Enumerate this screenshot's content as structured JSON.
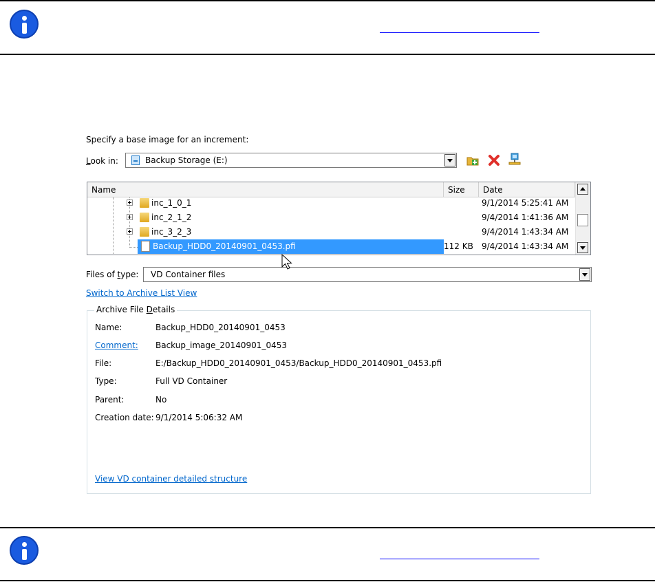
{
  "dialog": {
    "prompt": "Specify a base image for an increment:",
    "look_in": {
      "label": "Look in:",
      "value": "Backup Storage (E:)"
    },
    "toolbar": {
      "icons": [
        "new-folder-icon",
        "delete-icon",
        "network-icon"
      ]
    },
    "list": {
      "columns": [
        "Name",
        "Size",
        "Date"
      ],
      "rows": [
        {
          "name": "inc_1_0_1",
          "size": "",
          "date": "9/1/2014 5:25:41 AM",
          "type": "folder"
        },
        {
          "name": "inc_2_1_2",
          "size": "",
          "date": "9/4/2014 1:41:36 AM",
          "type": "folder"
        },
        {
          "name": "inc_3_2_3",
          "size": "",
          "date": "9/4/2014 1:43:34 AM",
          "type": "folder"
        },
        {
          "name": "Backup_HDD0_20140901_0453.pfi",
          "size": "112 KB",
          "date": "9/4/2014 1:43:34 AM",
          "type": "file",
          "selected": true
        }
      ]
    },
    "files_of_type": {
      "label": "Files of type:",
      "value": "VD Container files"
    },
    "switch_link": "Switch to Archive List View",
    "details": {
      "title": "Archive File Details",
      "rows": [
        {
          "key": "Name:",
          "value": "Backup_HDD0_20140901_0453"
        },
        {
          "key": "Comment:",
          "value": "Backup_image_20140901_0453"
        },
        {
          "key": "File:",
          "value": "E:/Backup_HDD0_20140901_0453/Backup_HDD0_20140901_0453.pfi"
        },
        {
          "key": "Type:",
          "value": "Full VD Container"
        },
        {
          "key": "Parent:",
          "value": "No"
        },
        {
          "key": "Creation date:",
          "value": "9/1/2014 5:06:32 AM"
        }
      ],
      "structure_link": "View VD container detailed structure"
    }
  },
  "colors": {
    "selection": "#3399ff",
    "link": "#0066cc",
    "info_icon": "#1a5be0"
  }
}
